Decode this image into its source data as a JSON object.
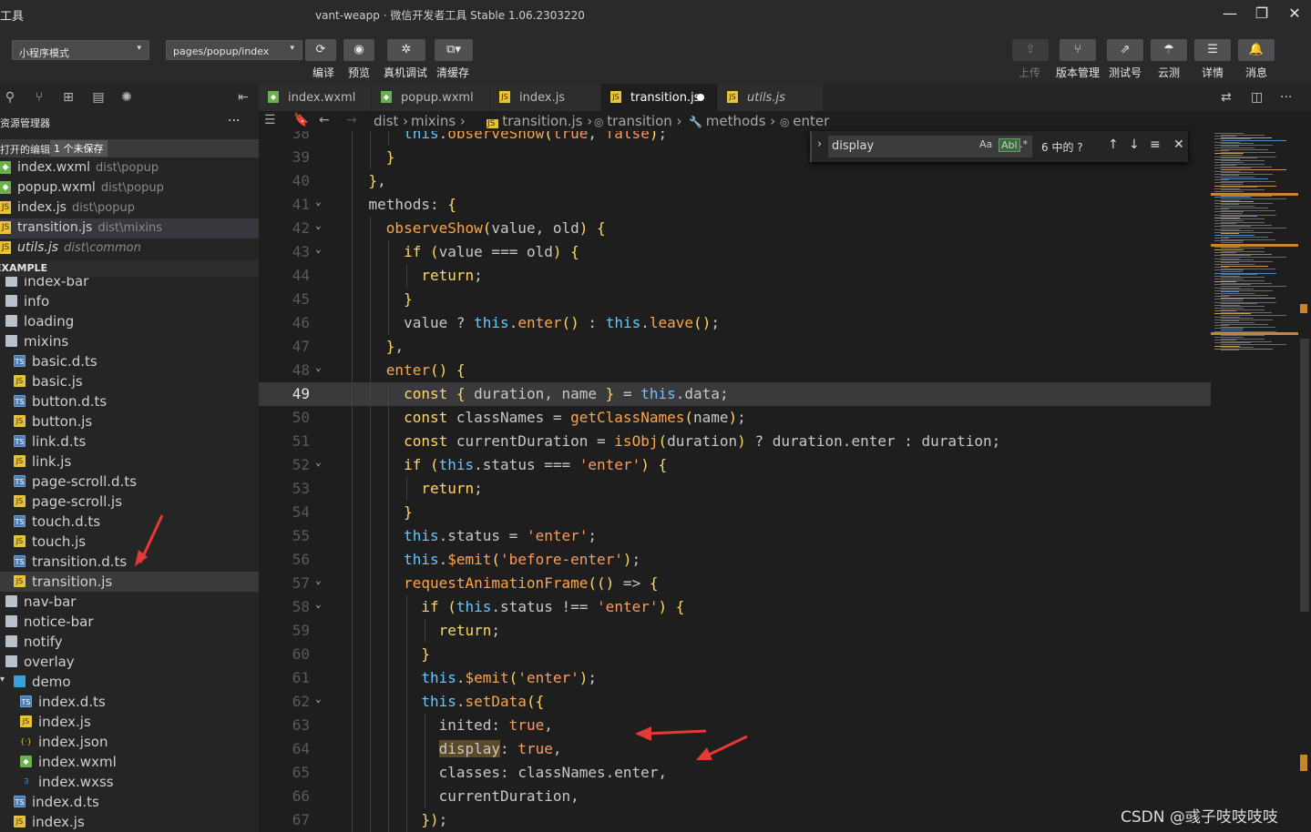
{
  "window": {
    "app_name": "工具",
    "title": "vant-weapp · 微信开发者工具 Stable 1.06.2303220",
    "min": "—",
    "max": "❐",
    "close": "✕"
  },
  "toolbar": {
    "mode_select": "小程序模式",
    "page_select": "pages/popup/index",
    "left_buttons": [
      {
        "label": "编译",
        "icon": "⟳"
      },
      {
        "label": "预览",
        "icon": "◉"
      },
      {
        "label": "真机调试",
        "icon": "✲"
      },
      {
        "label": "清缓存",
        "icon": "⧉▾"
      }
    ],
    "right_buttons": [
      {
        "label": "上传",
        "icon": "⇪",
        "disabled": true
      },
      {
        "label": "版本管理",
        "icon": "⑂"
      },
      {
        "label": "测试号",
        "icon": "⇗"
      },
      {
        "label": "云测",
        "icon": "☂"
      },
      {
        "label": "详情",
        "icon": "☰"
      },
      {
        "label": "消息",
        "icon": "🔔"
      }
    ]
  },
  "sidebar": {
    "panel_title": "资源管理器",
    "more": "···",
    "open_editors_label": "打开的编辑器",
    "unsaved_badge": "1 个未保存",
    "open_editors": [
      {
        "name": "index.wxml",
        "path": "dist\\popup",
        "type": "wxml"
      },
      {
        "name": "popup.wxml",
        "path": "dist\\popup",
        "type": "wxml"
      },
      {
        "name": "index.js",
        "path": "dist\\popup",
        "type": "js"
      },
      {
        "name": "transition.js",
        "path": "dist\\mixins",
        "type": "js"
      },
      {
        "name": "utils.js",
        "path": "dist\\common",
        "type": "js",
        "italic": true
      }
    ],
    "project_label": "EXAMPLE",
    "tree": [
      {
        "name": "index-bar",
        "type": "folder",
        "indent": 0
      },
      {
        "name": "info",
        "type": "folder",
        "indent": 0
      },
      {
        "name": "loading",
        "type": "folder",
        "indent": 0
      },
      {
        "name": "mixins",
        "type": "folder",
        "indent": 0
      },
      {
        "name": "basic.d.ts",
        "type": "ts",
        "indent": 1
      },
      {
        "name": "basic.js",
        "type": "js",
        "indent": 1
      },
      {
        "name": "button.d.ts",
        "type": "ts",
        "indent": 1
      },
      {
        "name": "button.js",
        "type": "js",
        "indent": 1
      },
      {
        "name": "link.d.ts",
        "type": "ts",
        "indent": 1
      },
      {
        "name": "link.js",
        "type": "js",
        "indent": 1
      },
      {
        "name": "page-scroll.d.ts",
        "type": "ts",
        "indent": 1
      },
      {
        "name": "page-scroll.js",
        "type": "js",
        "indent": 1
      },
      {
        "name": "touch.d.ts",
        "type": "ts",
        "indent": 1
      },
      {
        "name": "touch.js",
        "type": "js",
        "indent": 1
      },
      {
        "name": "transition.d.ts",
        "type": "ts",
        "indent": 1
      },
      {
        "name": "transition.js",
        "type": "js",
        "indent": 1,
        "selected": true
      },
      {
        "name": "nav-bar",
        "type": "folder",
        "indent": 0
      },
      {
        "name": "notice-bar",
        "type": "folder",
        "indent": 0
      },
      {
        "name": "notify",
        "type": "folder",
        "indent": 0
      },
      {
        "name": "overlay",
        "type": "folder",
        "indent": 0
      },
      {
        "name": "demo",
        "type": "folder-open",
        "indent": 1
      },
      {
        "name": "index.d.ts",
        "type": "ts",
        "indent": 2
      },
      {
        "name": "index.js",
        "type": "js",
        "indent": 2
      },
      {
        "name": "index.json",
        "type": "json",
        "indent": 2
      },
      {
        "name": "index.wxml",
        "type": "wxml",
        "indent": 2
      },
      {
        "name": "index.wxss",
        "type": "wxss",
        "indent": 2
      },
      {
        "name": "index.d.ts",
        "type": "ts",
        "indent": 1
      },
      {
        "name": "index.js",
        "type": "js",
        "indent": 1
      }
    ]
  },
  "editor": {
    "tabs": [
      {
        "label": "index.wxml",
        "type": "wxml"
      },
      {
        "label": "popup.wxml",
        "type": "wxml"
      },
      {
        "label": "index.js",
        "type": "js"
      },
      {
        "label": "transition.js",
        "type": "js",
        "active": true,
        "dirty": true
      },
      {
        "label": "utils.js",
        "type": "js",
        "italic": true
      }
    ],
    "breadcrumb": [
      "dist",
      "mixins",
      "transition.js",
      "transition",
      "methods",
      "enter"
    ],
    "find": {
      "query": "display",
      "match_case": "Aa",
      "whole_word": "Abl",
      "regex": ".*",
      "count": "6 中的 ?"
    },
    "current_line": 49,
    "lines": [
      {
        "n": "38",
        "code": "        this.observeShow(true, false);"
      },
      {
        "n": "39",
        "code": "      }"
      },
      {
        "n": "40",
        "code": "    },"
      },
      {
        "n": "41",
        "code": "    methods: {",
        "fold": true
      },
      {
        "n": "42",
        "code": "      observeShow(value, old) {",
        "fold": true
      },
      {
        "n": "43",
        "code": "        if (value === old) {",
        "fold": true
      },
      {
        "n": "44",
        "code": "          return;"
      },
      {
        "n": "45",
        "code": "        }"
      },
      {
        "n": "46",
        "code": "        value ? this.enter() : this.leave();"
      },
      {
        "n": "47",
        "code": "      },"
      },
      {
        "n": "48",
        "code": "      enter() {",
        "fold": true
      },
      {
        "n": "49",
        "code": "        const { duration, name } = this.data;"
      },
      {
        "n": "50",
        "code": "        const classNames = getClassNames(name);"
      },
      {
        "n": "51",
        "code": "        const currentDuration = isObj(duration) ? duration.enter : duration;"
      },
      {
        "n": "52",
        "code": "        if (this.status === 'enter') {",
        "fold": true
      },
      {
        "n": "53",
        "code": "          return;"
      },
      {
        "n": "54",
        "code": "        }"
      },
      {
        "n": "55",
        "code": "        this.status = 'enter';"
      },
      {
        "n": "56",
        "code": "        this.$emit('before-enter');"
      },
      {
        "n": "57",
        "code": "        requestAnimationFrame(() => {",
        "fold": true
      },
      {
        "n": "58",
        "code": "          if (this.status !== 'enter') {",
        "fold": true
      },
      {
        "n": "59",
        "code": "            return;"
      },
      {
        "n": "60",
        "code": "          }"
      },
      {
        "n": "61",
        "code": "          this.$emit('enter');"
      },
      {
        "n": "62",
        "code": "          this.setData({",
        "fold": true
      },
      {
        "n": "63",
        "code": "            inited: true,"
      },
      {
        "n": "64",
        "code": "            display: true,"
      },
      {
        "n": "65",
        "code": "            classes: classNames.enter,"
      },
      {
        "n": "66",
        "code": "            currentDuration,"
      },
      {
        "n": "67",
        "code": "          });"
      }
    ]
  },
  "watermark": "CSDN @彧子吱吱吱吱",
  "colors": {
    "annotation_arrow": "#e53935",
    "find_highlight": "#5a4a2a",
    "accent_scroll": "#c8862a"
  }
}
